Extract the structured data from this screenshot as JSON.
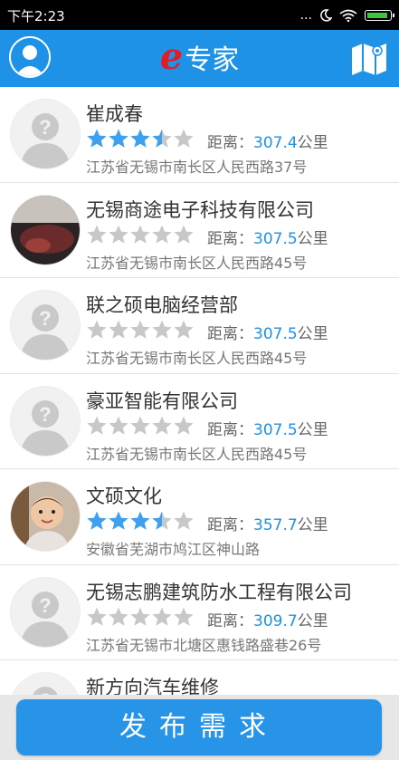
{
  "status_bar": {
    "time": "下午2:23",
    "dots": "..."
  },
  "header": {
    "title_e": "e",
    "title_text": "专家"
  },
  "list": [
    {
      "name": "崔成春",
      "rating": 3.5,
      "distance_label": "距离：",
      "distance": "307.4",
      "unit": "公里",
      "address": "江苏省无锡市南长区人民西路37号",
      "avatar": "placeholder"
    },
    {
      "name": "无锡商途电子科技有限公司",
      "rating": 0,
      "distance_label": "距离：",
      "distance": "307.5",
      "unit": "公里",
      "address": "江苏省无锡市南长区人民西路45号",
      "avatar": "photo"
    },
    {
      "name": "联之硕电脑经营部",
      "rating": 0,
      "distance_label": "距离：",
      "distance": "307.5",
      "unit": "公里",
      "address": "江苏省无锡市南长区人民西路45号",
      "avatar": "placeholder"
    },
    {
      "name": "豪亚智能有限公司",
      "rating": 0,
      "distance_label": "距离：",
      "distance": "307.5",
      "unit": "公里",
      "address": "江苏省无锡市南长区人民西路45号",
      "avatar": "placeholder"
    },
    {
      "name": "文硕文化",
      "rating": 3.5,
      "distance_label": "距离：",
      "distance": "357.7",
      "unit": "公里",
      "address": "安徽省芜湖市鸠江区神山路",
      "avatar": "photo"
    },
    {
      "name": "无锡志鹏建筑防水工程有限公司",
      "rating": 0,
      "distance_label": "距离：",
      "distance": "309.7",
      "unit": "公里",
      "address": "江苏省无锡市北塘区惠钱路盛巷26号",
      "avatar": "placeholder"
    },
    {
      "name": "新方向汽车维修",
      "rating": 0,
      "distance_label": "",
      "distance": "",
      "unit": "",
      "address": "",
      "avatar": "placeholder"
    }
  ],
  "footer": {
    "publish_label": "发布需求"
  },
  "colors": {
    "brand_blue": "#1e92e6",
    "star_blue": "#3fa0f0",
    "star_gray": "#c8c8c8",
    "title_red": "#e41b23"
  },
  "icons": {
    "user": "user-icon",
    "map": "map-icon",
    "wifi": "wifi-icon",
    "moon": "moon-icon",
    "battery": "battery-icon",
    "star": "star-icon",
    "question": "question-mark-icon"
  }
}
